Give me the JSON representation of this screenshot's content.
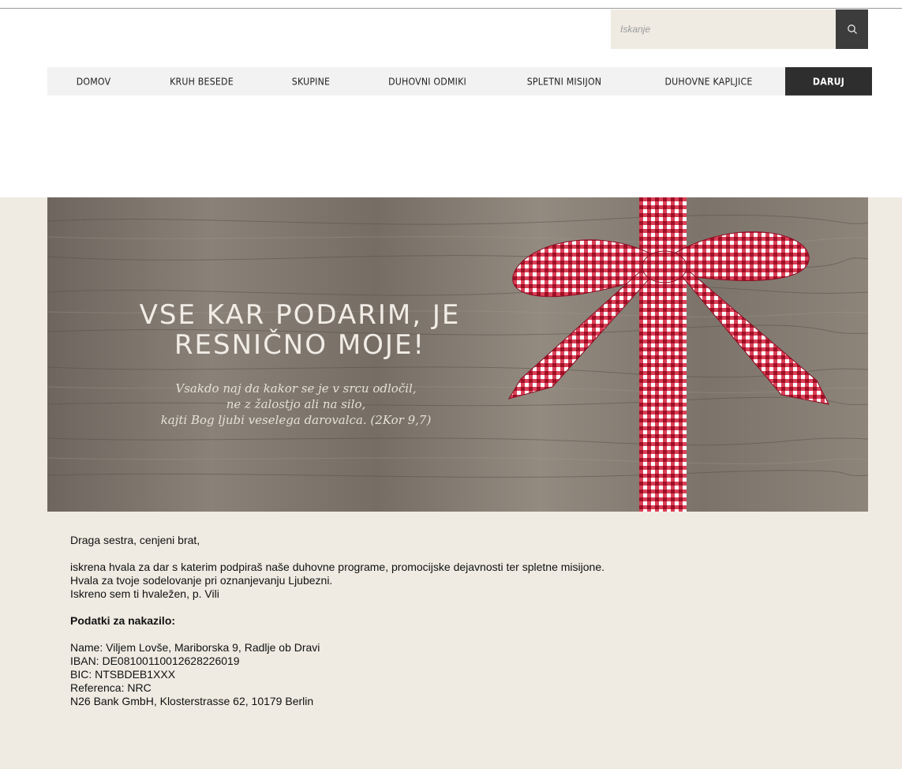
{
  "search": {
    "placeholder": "Iskanje",
    "icon": "search-icon"
  },
  "nav": {
    "items": [
      {
        "label": "DOMOV"
      },
      {
        "label": "KRUH BESEDE"
      },
      {
        "label": "SKUPINE"
      },
      {
        "label": "DUHOVNI ODMIKI"
      },
      {
        "label": "SPLETNI MISIJON"
      },
      {
        "label": "DUHOVNE KAPLJICE"
      },
      {
        "label": "DARUJ"
      }
    ]
  },
  "banner": {
    "title_line1": "VSE KAR PODARIM, JE",
    "title_line2": "RESNIČNO MOJE!",
    "quote_line1": "Vsakdo naj da kakor se je v srcu odločil,",
    "quote_line2": "ne z žalostjo ali na silo,",
    "quote_line3": "kajti Bog ljubi veselega darovalca. (2Kor 9,7)"
  },
  "content": {
    "greeting": "Draga sestra, cenjeni brat,",
    "line1": "iskrena hvala za dar s katerim podpiraš naše duhovne programe, promocijske dejavnosti ter spletne misijone.",
    "line2": "Hvala za tvoje sodelovanje pri oznanjevanju Ljubezni.",
    "line3": "Iskreno sem ti hvaležen, p. Vili",
    "heading": "Podatki za nakazilo:",
    "name": "Name: Viljem Lovše, Mariborska 9, Radlje ob Dravi",
    "iban": "IBAN: DE08100110012628226019",
    "bic": "BIC: NTSBDEB1XXX",
    "reference": "Referenca: NRC",
    "bank": "N26 Bank GmbH, Klosterstrasse 62, 10179 Berlin"
  },
  "colors": {
    "nav_active": "#2e2e2e",
    "page_bg": "#efebe2",
    "ribbon": "#c8102e"
  }
}
